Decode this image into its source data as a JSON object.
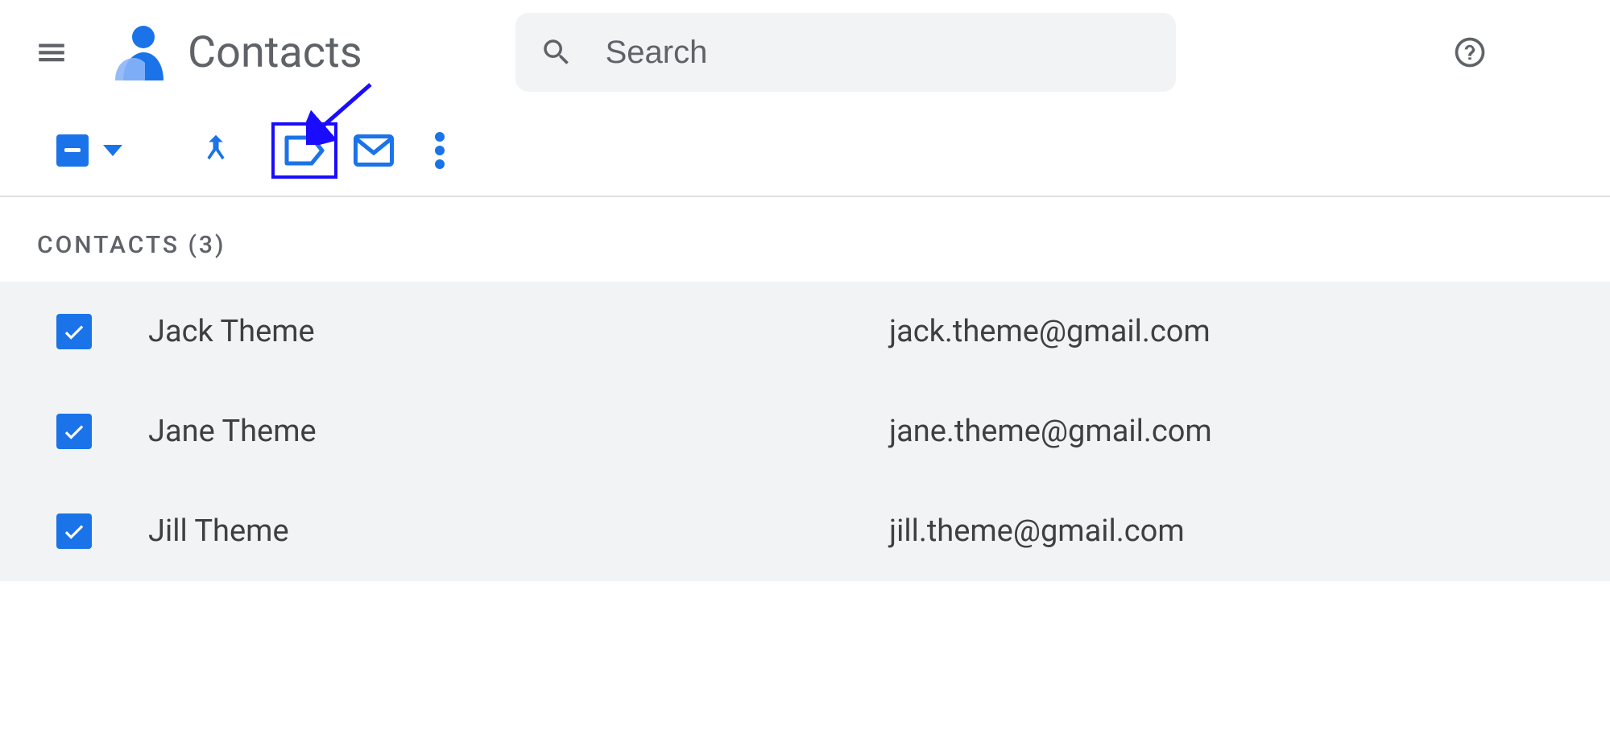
{
  "header": {
    "app_title": "Contacts",
    "search_placeholder": "Search"
  },
  "section": {
    "label": "CONTACTS (3)"
  },
  "contacts": [
    {
      "name": "Jack Theme",
      "email": "jack.theme@gmail.com",
      "checked": true
    },
    {
      "name": "Jane Theme",
      "email": "jane.theme@gmail.com",
      "checked": true
    },
    {
      "name": "Jill Theme",
      "email": "jill.theme@gmail.com",
      "checked": true
    }
  ]
}
